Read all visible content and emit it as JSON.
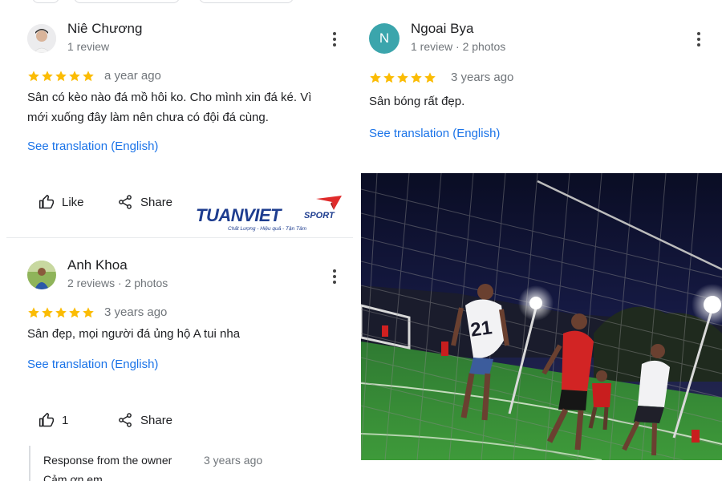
{
  "colors": {
    "star": "#fbbc04",
    "link": "#1a73e8",
    "secondary_text": "#70757a",
    "avatar_n": "#3ba5ac",
    "logo_blue": "#1e3d8f",
    "logo_red": "#e02b2b"
  },
  "reviews": [
    {
      "name": "Niê Chương",
      "meta": "1 review",
      "rating": 5,
      "ago": "a year ago",
      "text": "Sân có kèo nào đá mồ hôi ko. Cho mình xin đá ké. Vì mới xuống đây làm nên chưa có đội đá cùng.",
      "translate": "See translation (English)",
      "like_label": "Like",
      "share_label": "Share"
    },
    {
      "name": "Ngoai Bya",
      "avatar_letter": "N",
      "meta": "1 review · 2 photos",
      "rating": 5,
      "ago": "3 years ago",
      "text": "Sân bóng rất đẹp.",
      "translate": "See translation (English)"
    },
    {
      "name": "Anh Khoa",
      "meta": "2 reviews · 2 photos",
      "rating": 5,
      "ago": "3 years ago",
      "text": "Sân đẹp, mọi người đá ủng hộ A tui nha",
      "translate": "See translation (English)",
      "like_label": "1",
      "share_label": "Share",
      "response": {
        "title": "Response from the owner",
        "ago": "3 years ago",
        "text": "Cảm ơn em"
      }
    }
  ],
  "logo": {
    "main": "TUANVIET",
    "sport": "SPORT",
    "tagline": "Chất Lượng - Hiệu quả - Tận Tâm"
  },
  "photo": {
    "jersey_number": "21"
  }
}
